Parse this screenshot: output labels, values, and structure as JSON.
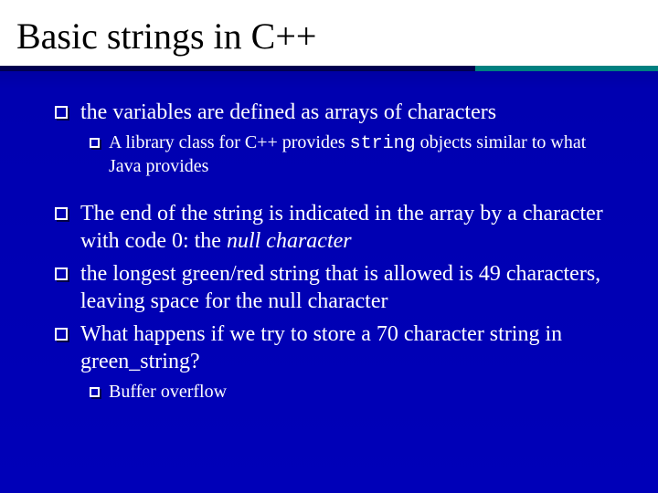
{
  "title": "Basic strings in C++",
  "bullets": {
    "b1": "the variables are defined as arrays of characters",
    "b1a_pre": "A library class for C++ provides ",
    "b1a_code": "string",
    "b1a_post": " objects similar to what Java provides",
    "b2_pre": "The end of the string is indicated in the array by a character with code 0: the ",
    "b2_ital": "null character",
    "b3": "the longest green/red string that is allowed is 49 characters, leaving space for the null character",
    "b4": "What happens if we try to store a 70 character string in green_string?",
    "b4a": "Buffer overflow"
  }
}
